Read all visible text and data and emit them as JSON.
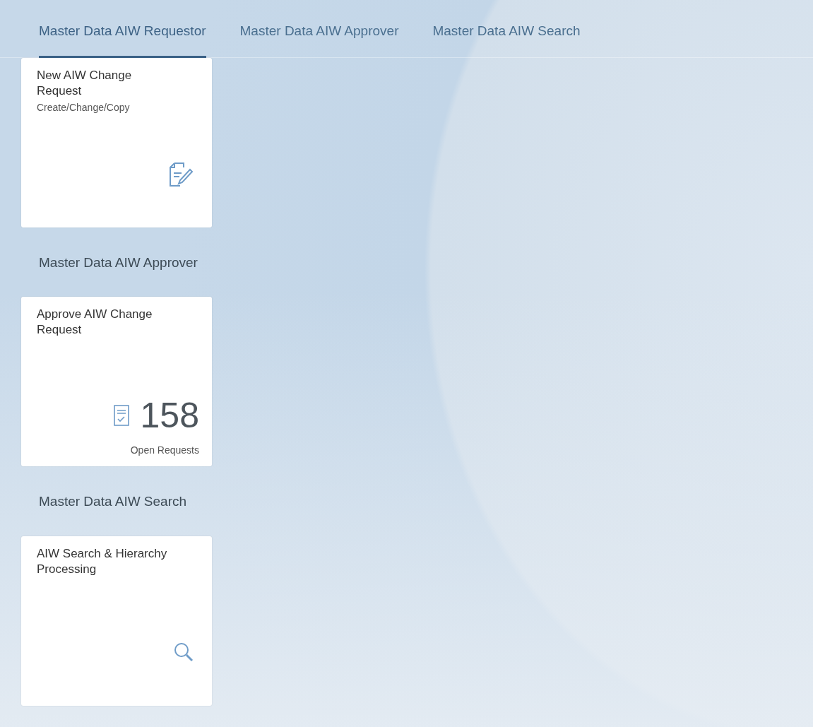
{
  "tabs": [
    {
      "label": "Master Data AIW Requestor",
      "selected": true
    },
    {
      "label": "Master Data AIW Approver",
      "selected": false
    },
    {
      "label": "Master Data AIW Search",
      "selected": false
    }
  ],
  "groups": [
    {
      "tiles": [
        {
          "kind": "edit",
          "title": "New AIW Change Request",
          "subtitle": "Create/Change/Copy"
        }
      ]
    },
    {
      "title": "Master Data AIW Approver",
      "tiles": [
        {
          "kind": "approve",
          "title": "Approve AIW Change Request",
          "count": "158",
          "unit": "Open Requests"
        }
      ]
    },
    {
      "title": "Master Data AIW Search",
      "tiles": [
        {
          "kind": "search",
          "title": "AIW Search & Hierarchy Processing"
        }
      ]
    }
  ]
}
